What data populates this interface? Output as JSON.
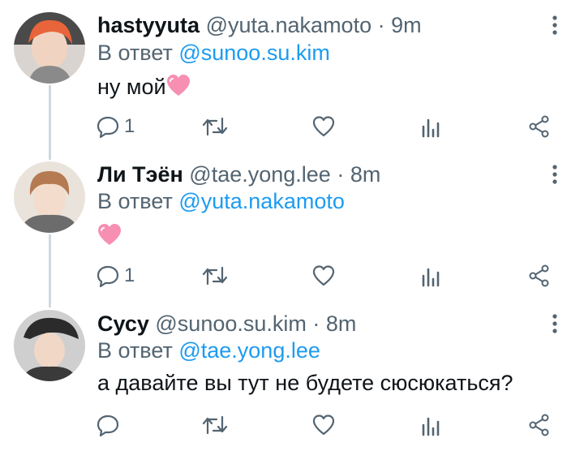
{
  "tweets": [
    {
      "name": "hastyyuta",
      "handle": "@yuta.nakamoto",
      "separator": "·",
      "time": "9m",
      "reply_prefix": "В ответ",
      "reply_mention": "@sunoo.su.kim",
      "text": "ну мой",
      "reply_count": "1",
      "avatar_color": "#e8643a"
    },
    {
      "name": "Ли Тэён",
      "handle": "@tae.yong.lee",
      "separator": "·",
      "time": "8m",
      "reply_prefix": "В ответ",
      "reply_mention": "@yuta.nakamoto",
      "text": "",
      "reply_count": "1",
      "avatar_color": "#b57a52"
    },
    {
      "name": "Сусу",
      "handle": "@sunoo.su.kim",
      "separator": "·",
      "time": "8m",
      "reply_prefix": "В ответ",
      "reply_mention": "@tae.yong.lee",
      "text": "а давайте вы тут не будете сюсюкаться?",
      "reply_count": "",
      "avatar_color": "#2b2b2b"
    }
  ],
  "colors": {
    "accent": "#1d9bf0",
    "muted": "#536471",
    "heart": "#f78fb3",
    "thread_line": "#cfd9de"
  },
  "icons": [
    "reply-icon",
    "retweet-icon",
    "like-icon",
    "analytics-icon",
    "share-icon",
    "more-icon",
    "heart-emoji"
  ]
}
